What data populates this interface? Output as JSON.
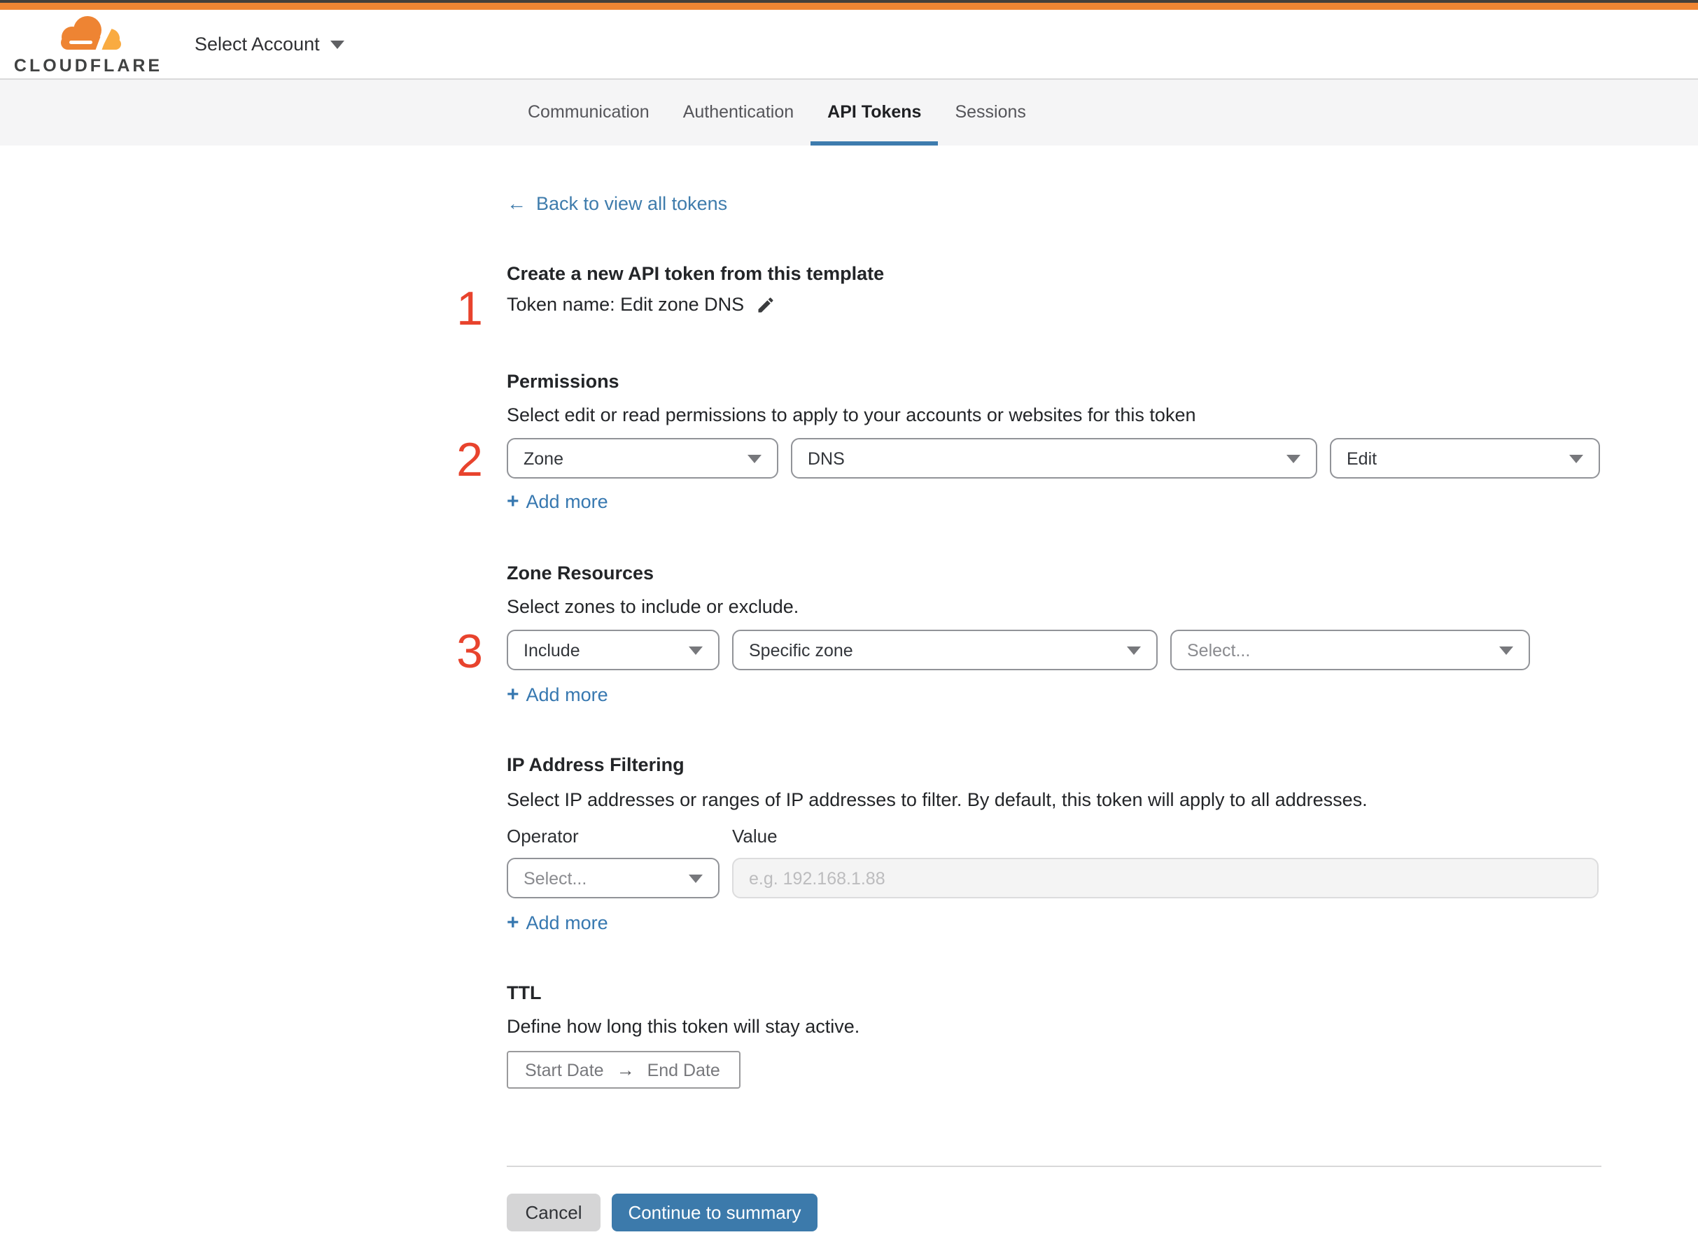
{
  "brand": {
    "logo_text": "CLOUDFLARE",
    "account_selector": "Select Account"
  },
  "tabs": [
    {
      "label": "Communication",
      "active": false
    },
    {
      "label": "Authentication",
      "active": false
    },
    {
      "label": "API Tokens",
      "active": true
    },
    {
      "label": "Sessions",
      "active": false
    }
  ],
  "back_link": {
    "arrow": "←",
    "label": "Back to view all tokens"
  },
  "steps": [
    "1",
    "2",
    "3"
  ],
  "template": {
    "heading": "Create a new API token from this template",
    "token_name_line": "Token name: Edit zone DNS"
  },
  "permissions": {
    "heading": "Permissions",
    "description": "Select edit or read permissions to apply to your accounts or websites for this token",
    "selects": [
      {
        "value": "Zone"
      },
      {
        "value": "DNS"
      },
      {
        "value": "Edit"
      }
    ]
  },
  "zone_resources": {
    "heading": "Zone Resources",
    "description": "Select zones to include or exclude.",
    "selects": [
      {
        "value": "Include"
      },
      {
        "value": "Specific zone"
      },
      {
        "value": "Select...",
        "placeholder": true
      }
    ]
  },
  "ip_filtering": {
    "heading": "IP Address Filtering",
    "description": "Select IP addresses or ranges of IP addresses to filter. By default, this token will apply to all addresses.",
    "operator_label": "Operator",
    "value_label": "Value",
    "operator_select": "Select...",
    "value_placeholder": "e.g. 192.168.1.88"
  },
  "ttl": {
    "heading": "TTL",
    "description": "Define how long this token will stay active.",
    "start_date": "Start Date",
    "end_date": "End Date",
    "arrow": "→"
  },
  "actions": {
    "plus": "+",
    "add_more": "Add more",
    "cancel": "Cancel",
    "continue": "Continue to summary"
  },
  "colors": {
    "accent_orange": "#ef8633",
    "step_number_red": "#e8432d",
    "link_blue": "#3f7cac",
    "primary_button_blue": "#3c7aab",
    "active_tab_underline": "#3e7cae",
    "tab_band_gray": "#f5f5f6"
  }
}
